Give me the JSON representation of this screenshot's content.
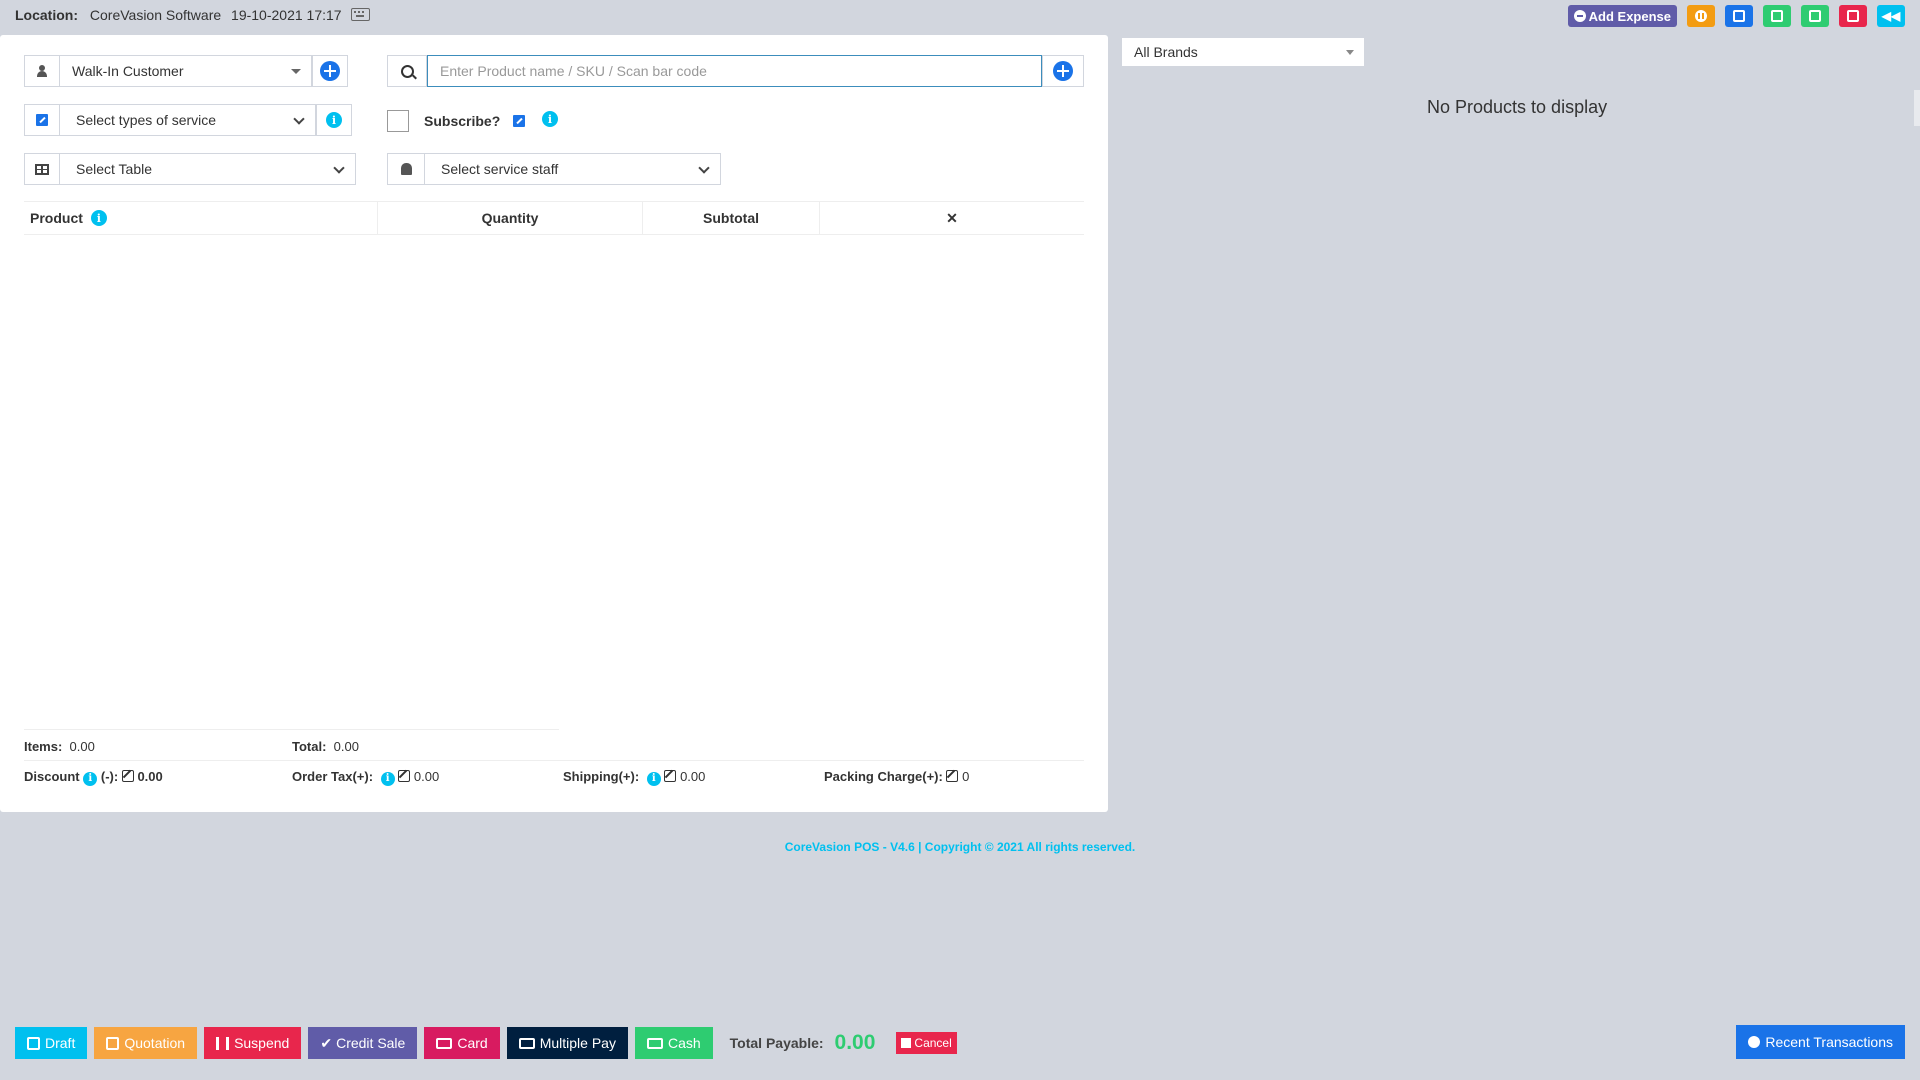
{
  "header": {
    "location_label": "Location:",
    "location_value": "CoreVasion Software",
    "datetime": "19-10-2021 17:17",
    "add_expense_label": "Add Expense"
  },
  "form": {
    "customer_value": "Walk-In Customer",
    "search_placeholder": "Enter Product name / SKU / Scan bar code",
    "service_type_value": "Select types of service",
    "subscribe_label": "Subscribe?",
    "table_value": "Select Table",
    "staff_value": "Select service staff"
  },
  "table": {
    "columns": [
      "Product",
      "Quantity",
      "Subtotal",
      "✕"
    ]
  },
  "totals": {
    "items_label": "Items:",
    "items_value": "0.00",
    "total_label": "Total:",
    "total_value": "0.00",
    "discount_label": "Discount",
    "discount_suffix": "(-):",
    "discount_value": "0.00",
    "order_tax_label": "Order Tax(+):",
    "order_tax_value": "0.00",
    "shipping_label": "Shipping(+):",
    "shipping_value": "0.00",
    "packing_label": "Packing Charge(+):",
    "packing_value": "0"
  },
  "products": {
    "brand_filter": "All Brands",
    "empty_message": "No Products to display"
  },
  "footer": {
    "copyright": "CoreVasion POS - V4.6 | Copyright © 2021 All rights reserved."
  },
  "actions": {
    "draft": "Draft",
    "quotation": "Quotation",
    "suspend": "Suspend",
    "credit_sale": "Credit Sale",
    "card": "Card",
    "multiple_pay": "Multiple Pay",
    "cash": "Cash",
    "total_payable_label": "Total Payable:",
    "total_payable_value": "0.00",
    "cancel": "Cancel",
    "recent_transactions": "Recent Transactions"
  },
  "colors": {
    "background": "#d2d6de",
    "primary": "#1a73e8",
    "info": "#00c0ef",
    "success": "#2ecc71",
    "danger": "#e8264c",
    "warning": "#f39c12",
    "purple": "#605ca8",
    "navy": "#001f3f"
  }
}
